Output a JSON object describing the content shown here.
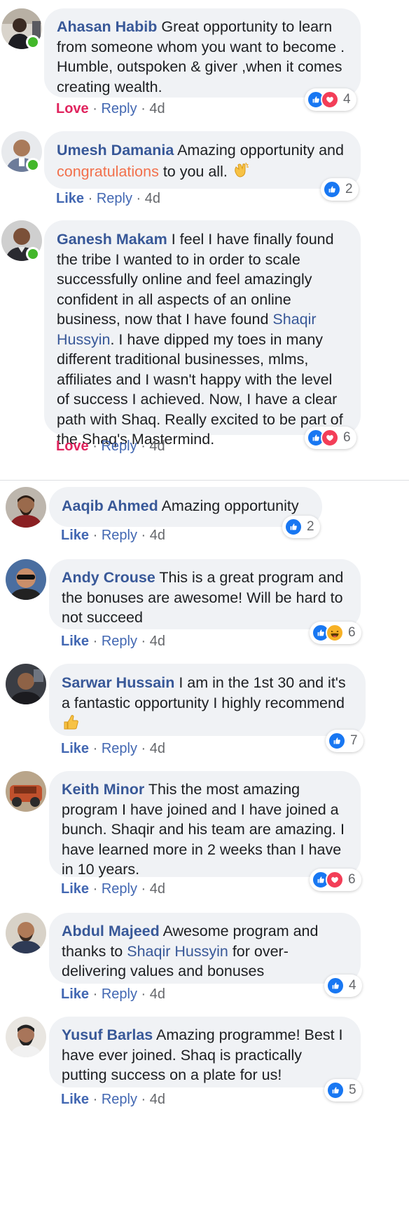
{
  "comments": [
    {
      "author": "Ahasan Habib",
      "text": "Great opportunity to learn from someone whom you want to become . Humble, outspoken & giver ,when it comes creating wealth.",
      "reaction_action": "Love",
      "reply": "Reply",
      "time": "4d",
      "reaction_count": "4",
      "reactions": [
        "like-icon",
        "love-icon"
      ]
    },
    {
      "author": "Umesh Damania",
      "text_1": "Amazing opportunity and",
      "highlight": "congratulations",
      "text_2": "to you all.",
      "emoji": "clapping-hands-icon",
      "reaction_action": "Like",
      "reply": "Reply",
      "time": "4d",
      "reaction_count": "2",
      "reactions": [
        "like-icon"
      ]
    },
    {
      "author": "Ganesh Makam",
      "text_1": "I feel I have finally found the tribe I wanted to in order to scale successfully online and feel amazingly confident in all aspects of an online business, now that I have found",
      "mention": "Shaqir Hussyin",
      "text_2": ". I have dipped my toes in many different traditional businesses, mlms, affiliates and I wasn't happy with the level of success I achieved. Now, I have a clear path with Shaq. Really excited to be part of the Shaq's Mastermind.",
      "reaction_action": "Love",
      "reply": "Reply",
      "time": "4d",
      "reaction_count": "6",
      "reactions": [
        "like-icon",
        "love-icon"
      ]
    },
    {
      "author": "Aaqib Ahmed",
      "text": "Amazing opportunity",
      "reaction_action": "Like",
      "reply": "Reply",
      "time": "4d",
      "reaction_count": "2",
      "reactions": [
        "like-icon"
      ]
    },
    {
      "author": "Andy Crouse",
      "text": "This is a great program and the bonuses are awesome! Will be hard to not succeed",
      "reaction_action": "Like",
      "reply": "Reply",
      "time": "4d",
      "reaction_count": "6",
      "reactions": [
        "like-icon",
        "haha-icon"
      ]
    },
    {
      "author": "Sarwar Hussain",
      "text": "I am in the 1st 30 and it's a fantastic opportunity I highly recommend",
      "emoji": "thumbs-up-emoji",
      "reaction_action": "Like",
      "reply": "Reply",
      "time": "4d",
      "reaction_count": "7",
      "reactions": [
        "like-icon"
      ]
    },
    {
      "author": "Keith Minor",
      "text": "This the most amazing program I have joined and I have joined a bunch. Shaqir and his team are amazing. I have learned more in 2 weeks than I have in 10 years.",
      "reaction_action": "Like",
      "reply": "Reply",
      "time": "4d",
      "reaction_count": "6",
      "reactions": [
        "like-icon",
        "love-icon"
      ]
    },
    {
      "author": "Abdul Majeed",
      "text_1": "Awesome program and thanks to",
      "mention": "Shaqir Hussyin",
      "text_2": "for over-delivering values and bonuses",
      "reaction_action": "Like",
      "reply": "Reply",
      "time": "4d",
      "reaction_count": "4",
      "reactions": [
        "like-icon"
      ]
    },
    {
      "author": "Yusuf Barlas",
      "text": "Amazing programme! Best I have ever joined. Shaq is practically putting success on a plate for us!",
      "reaction_action": "Like",
      "reply": "Reply",
      "time": "4d",
      "reaction_count": "5",
      "reactions": [
        "like-icon"
      ]
    }
  ],
  "separator": "·",
  "colors": {
    "link": "#385898",
    "like": "#4267b2",
    "love": "#e0245e",
    "bubble": "#f0f2f5",
    "meta": "#65676b",
    "online": "#42b72a"
  }
}
